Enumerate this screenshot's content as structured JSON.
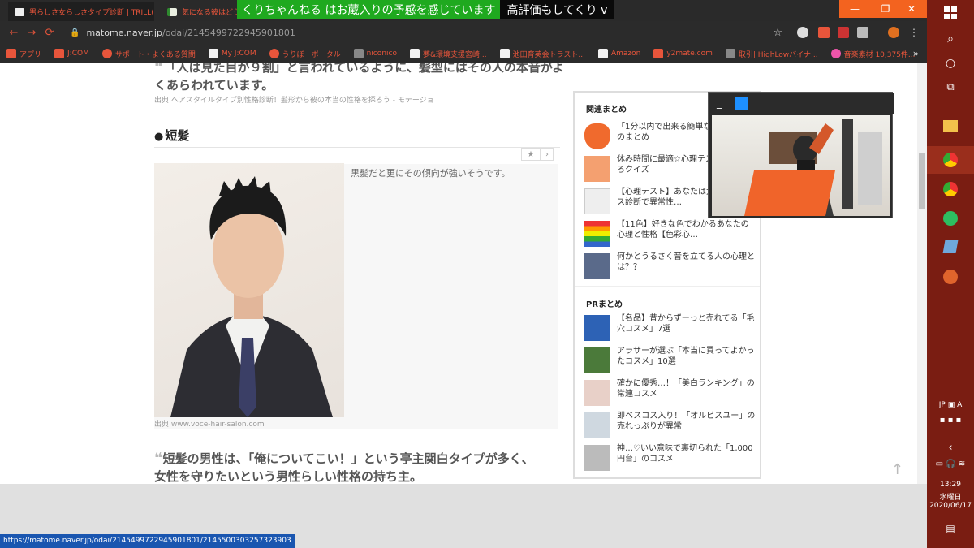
{
  "tabs": [
    {
      "title": "男らしさ女らしさタイプ診断 | TRILL(",
      "close": "✕"
    },
    {
      "title": "気になる彼はどう?",
      "close": "✕"
    }
  ],
  "ticker": {
    "green_text": "くりちゃんねる はお蔵入りの予感を感じています",
    "black_text": "高評価もしてくり v"
  },
  "window_controls": {
    "minimize": "—",
    "maximize": "❐",
    "close": "✕"
  },
  "nav": {
    "back": "←",
    "forward": "→",
    "reload": "⟳"
  },
  "address": {
    "host": "matome.naver.jp",
    "path": "/odai/2145499722945901801"
  },
  "bookmarks": [
    {
      "label": "アプリ",
      "icon": "apps-icon"
    },
    {
      "label": "J:COM",
      "icon": "jcom-icon"
    },
    {
      "label": "サポート・よくある質問",
      "icon": "globe-icon"
    },
    {
      "label": "My J:COM",
      "icon": "myjcom-icon"
    },
    {
      "label": "うりぼーポータル",
      "icon": "globe-icon"
    },
    {
      "label": "niconico",
      "icon": "niconico-icon"
    },
    {
      "label": "夢&環境支援宮崎...",
      "icon": "page-icon"
    },
    {
      "label": "池田育英会トラスト...",
      "icon": "page-icon"
    },
    {
      "label": "Amazon",
      "icon": "amazon-icon"
    },
    {
      "label": "y2mate.com",
      "icon": "download-icon"
    },
    {
      "label": "取引| HighLowバイナ...",
      "icon": "link-icon"
    },
    {
      "label": "音楽素材 10,375件...",
      "icon": "music-icon"
    }
  ],
  "bookmarks_more": "»",
  "article": {
    "quote_top": "「人は見た目が９割」と言われているように、髪型にはその人の本音がよくあらわれています。",
    "source": "出典 ヘアスタイルタイプ別性格診断！髪形から彼の本当の性格を探ろう - モテージョ",
    "heading": "短髪",
    "heading_bullet": "●",
    "caption": "黒髪だと更にその傾向が強いそうです。",
    "photo_source": "出典 www.voce-hair-salon.com",
    "bottom_quote": "短髪の男性は、「俺についてこい！」という亭主関白タイプが多く、女性を守りたいという男性らしい性格の持ち主。",
    "star": "★",
    "next": "›"
  },
  "sidebar": {
    "related_title": "関連まとめ",
    "related": [
      "「1分以内で出来る簡単な心理テスト」のまとめ",
      "休み時間に最適☆心理テスト・おもしろクイズ",
      "【心理テスト】あなたは大丈夫？コパス診断で異常性…",
      "【11色】好きな色でわかるあなたの心理と性格【色彩心…",
      "何かとうるさく音を立てる人の心理とは？？"
    ],
    "pr_title": "PRまとめ",
    "pr": [
      "【名品】昔からずーっと売れてる「毛穴コスメ」7選",
      "アラサーが選ぶ「本当に買ってよかったコスメ」10選",
      "確かに優秀…！「美白ランキング」の常連コスメ",
      "即ベスコス入り！「オルビスユー」の売れっぷりが異常",
      "神…♡いい意味で裏切られた「1,000円台」のコスメ"
    ]
  },
  "scroll_top": "↑",
  "status_url": "https://matome.naver.jp/odai/2145499722945901801/2145500303257323903",
  "cam": {
    "minimize": "_"
  },
  "taskbar": {
    "ime": "JP",
    "ime_mode": "A",
    "time": "13:29",
    "weekday": "水曜日",
    "date": "2020/06/17",
    "chevron": "‹"
  },
  "colors": {
    "accent": "#e8553b",
    "taskbar": "#7a1d12",
    "window_button": "#f3631f",
    "ticker_green": "#1fa91f"
  }
}
